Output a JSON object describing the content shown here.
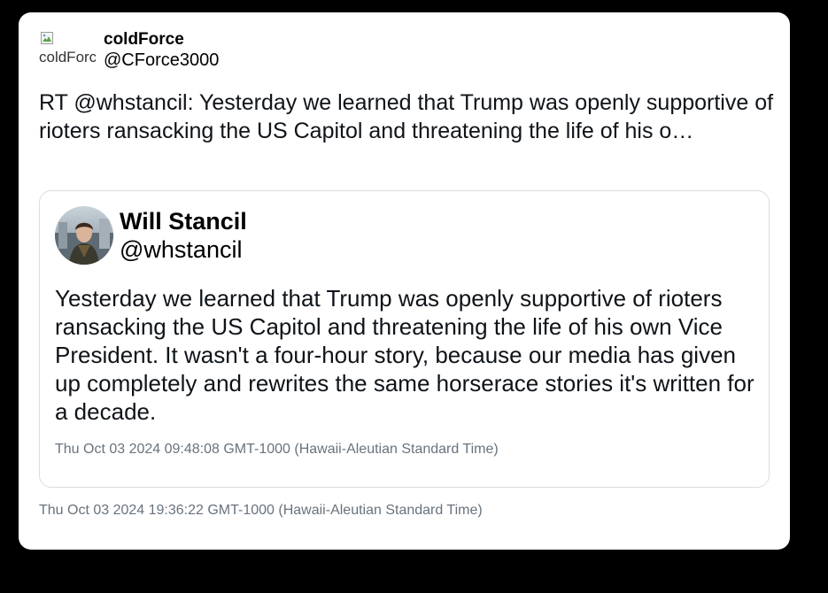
{
  "tweet": {
    "author": {
      "display_name": "coldForce",
      "handle": "@CForce3000",
      "avatar_alt": "coldForce"
    },
    "text": "RT @whstancil: Yesterday we learned that Trump was openly supportive of rioters ransacking the US Capitol and threatening the life of his o…",
    "timestamp": "Thu Oct 03 2024 19:36:22 GMT-1000 (Hawaii-Aleutian Standard Time)"
  },
  "quoted": {
    "author": {
      "display_name": "Will Stancil",
      "handle": "@whstancil"
    },
    "text": "Yesterday we learned that Trump was openly supportive of rioters ransacking the US Capitol and threatening the life of his own Vice President. It wasn't a four-hour story, because our media has given up completely and rewrites the same horserace stories it's written for a decade.",
    "timestamp": "Thu Oct 03 2024 09:48:08 GMT-1000 (Hawaii-Aleutian Standard Time)"
  },
  "icons": {
    "broken_image": "broken-image-icon"
  },
  "colors": {
    "page_background": "#000000",
    "card_background": "#ffffff",
    "timestamp": "#68737d",
    "quote_border": "#d9dde1"
  }
}
